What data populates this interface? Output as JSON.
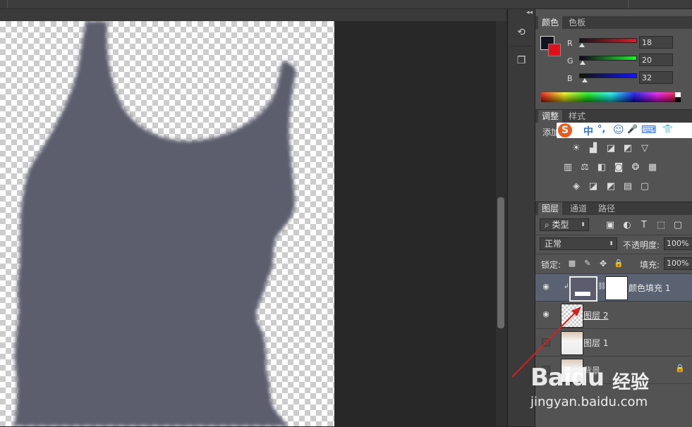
{
  "colors": {
    "foreground": "#121420",
    "background": "#e0101a",
    "fill_shape": "#5b5d6d",
    "arrow": "#d6201e",
    "selected_layer": "#5a6272"
  },
  "color_panel": {
    "tabs": [
      "颜色",
      "色板"
    ],
    "active_tab": "颜色",
    "channels": [
      {
        "label": "R",
        "value": "18"
      },
      {
        "label": "G",
        "value": "20"
      },
      {
        "label": "B",
        "value": "32"
      }
    ]
  },
  "adjustments_panel": {
    "tabs": [
      "调整",
      "样式"
    ],
    "active_tab": "调整",
    "add_label": "添加",
    "ime_toolbar": [
      "中",
      "°,",
      "☺",
      "🎤",
      "⌨",
      "👕"
    ],
    "ime_logo": "S",
    "row1_icons": [
      "brightness-icon",
      "levels-icon",
      "curves-icon",
      "exposure-icon",
      "vibrance-icon"
    ],
    "row2_icons": [
      "hue-saturation-icon",
      "color-balance-icon",
      "black-white-icon",
      "photo-filter-icon",
      "channel-mixer-icon",
      "color-lookup-icon"
    ],
    "row3_icons": [
      "invert-icon",
      "posterize-icon",
      "threshold-icon",
      "gradient-map-icon"
    ]
  },
  "layers_panel": {
    "tabs": [
      "图层",
      "通道",
      "路径"
    ],
    "active_tab": "图层",
    "filter_kind": "类型",
    "blend_mode": "正常",
    "opacity_label": "不透明度:",
    "opacity_value": "100%",
    "lock_label": "锁定:",
    "fill_label": "填充:",
    "fill_value": "100%",
    "layers": [
      {
        "name": "颜色填充 1",
        "visible": true,
        "selected": true
      },
      {
        "name": "图层 2",
        "visible": true,
        "selected": false
      },
      {
        "name": "图层 1",
        "visible": false,
        "selected": false
      },
      {
        "name": "背景",
        "visible": false,
        "selected": false,
        "locked": true
      }
    ]
  },
  "watermark": {
    "logo_text": "Baidu",
    "product": "经验",
    "url": "jingyan.baidu.com"
  }
}
